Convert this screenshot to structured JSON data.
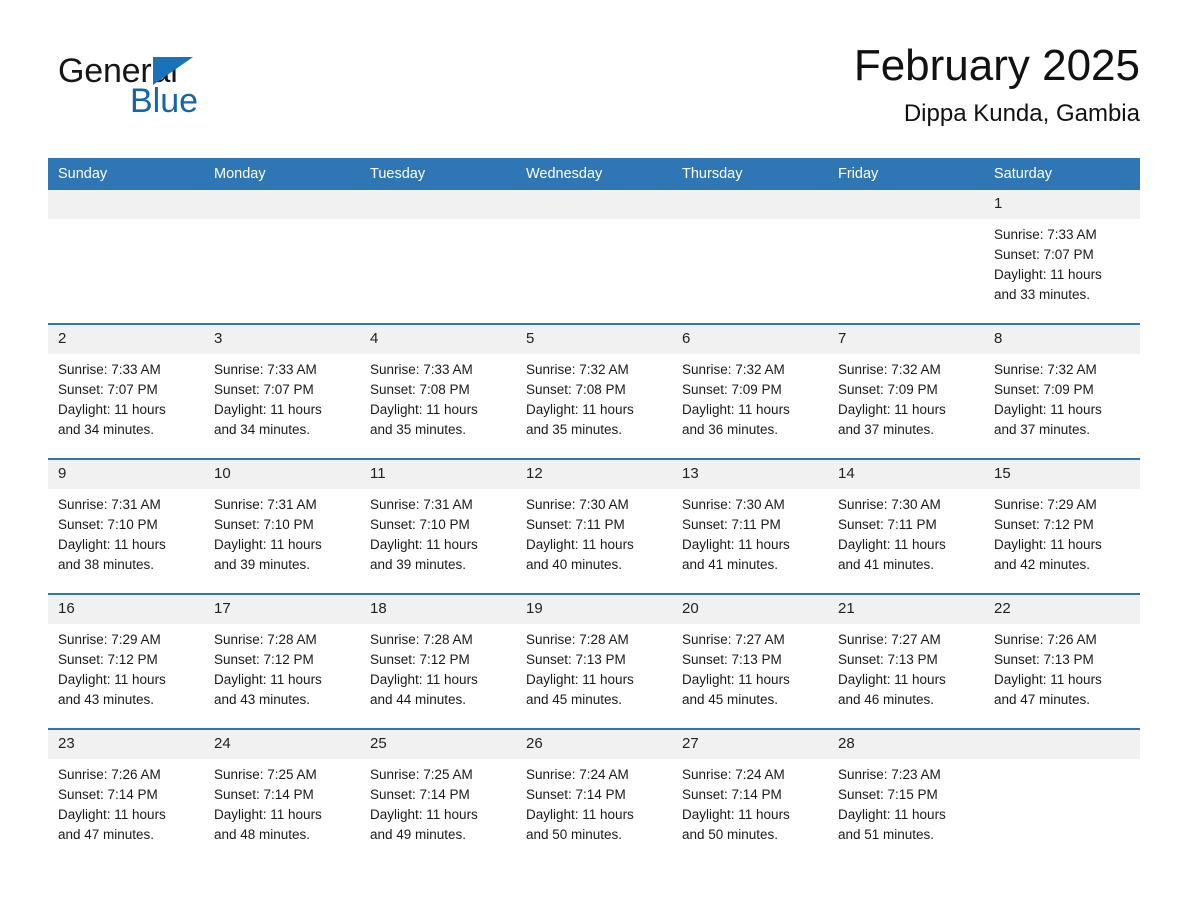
{
  "brand": {
    "name_part1": "General",
    "name_part2": "Blue",
    "triangle_color": "#1c72b8",
    "blue_color": "#1565ac"
  },
  "header": {
    "month_title": "February 2025",
    "location": "Dippa Kunda, Gambia"
  },
  "theme": {
    "header_blue": "#2f76b5",
    "row_divider_blue": "#2f76b5",
    "daynum_band": "#f1f1f1",
    "text": "#1a1a1a"
  },
  "weekday_headers": [
    "Sunday",
    "Monday",
    "Tuesday",
    "Wednesday",
    "Thursday",
    "Friday",
    "Saturday"
  ],
  "labels": {
    "sunrise_prefix": "Sunrise: ",
    "sunset_prefix": "Sunset: ",
    "daylight_prefix": "Daylight: "
  },
  "weeks": [
    [
      {
        "day": "",
        "sunrise": "",
        "sunset": "",
        "daylight_line1": "",
        "daylight_line2": ""
      },
      {
        "day": "",
        "sunrise": "",
        "sunset": "",
        "daylight_line1": "",
        "daylight_line2": ""
      },
      {
        "day": "",
        "sunrise": "",
        "sunset": "",
        "daylight_line1": "",
        "daylight_line2": ""
      },
      {
        "day": "",
        "sunrise": "",
        "sunset": "",
        "daylight_line1": "",
        "daylight_line2": ""
      },
      {
        "day": "",
        "sunrise": "",
        "sunset": "",
        "daylight_line1": "",
        "daylight_line2": ""
      },
      {
        "day": "",
        "sunrise": "",
        "sunset": "",
        "daylight_line1": "",
        "daylight_line2": ""
      },
      {
        "day": "1",
        "sunrise": "Sunrise: 7:33 AM",
        "sunset": "Sunset: 7:07 PM",
        "daylight_line1": "Daylight: 11 hours",
        "daylight_line2": "and 33 minutes."
      }
    ],
    [
      {
        "day": "2",
        "sunrise": "Sunrise: 7:33 AM",
        "sunset": "Sunset: 7:07 PM",
        "daylight_line1": "Daylight: 11 hours",
        "daylight_line2": "and 34 minutes."
      },
      {
        "day": "3",
        "sunrise": "Sunrise: 7:33 AM",
        "sunset": "Sunset: 7:07 PM",
        "daylight_line1": "Daylight: 11 hours",
        "daylight_line2": "and 34 minutes."
      },
      {
        "day": "4",
        "sunrise": "Sunrise: 7:33 AM",
        "sunset": "Sunset: 7:08 PM",
        "daylight_line1": "Daylight: 11 hours",
        "daylight_line2": "and 35 minutes."
      },
      {
        "day": "5",
        "sunrise": "Sunrise: 7:32 AM",
        "sunset": "Sunset: 7:08 PM",
        "daylight_line1": "Daylight: 11 hours",
        "daylight_line2": "and 35 minutes."
      },
      {
        "day": "6",
        "sunrise": "Sunrise: 7:32 AM",
        "sunset": "Sunset: 7:09 PM",
        "daylight_line1": "Daylight: 11 hours",
        "daylight_line2": "and 36 minutes."
      },
      {
        "day": "7",
        "sunrise": "Sunrise: 7:32 AM",
        "sunset": "Sunset: 7:09 PM",
        "daylight_line1": "Daylight: 11 hours",
        "daylight_line2": "and 37 minutes."
      },
      {
        "day": "8",
        "sunrise": "Sunrise: 7:32 AM",
        "sunset": "Sunset: 7:09 PM",
        "daylight_line1": "Daylight: 11 hours",
        "daylight_line2": "and 37 minutes."
      }
    ],
    [
      {
        "day": "9",
        "sunrise": "Sunrise: 7:31 AM",
        "sunset": "Sunset: 7:10 PM",
        "daylight_line1": "Daylight: 11 hours",
        "daylight_line2": "and 38 minutes."
      },
      {
        "day": "10",
        "sunrise": "Sunrise: 7:31 AM",
        "sunset": "Sunset: 7:10 PM",
        "daylight_line1": "Daylight: 11 hours",
        "daylight_line2": "and 39 minutes."
      },
      {
        "day": "11",
        "sunrise": "Sunrise: 7:31 AM",
        "sunset": "Sunset: 7:10 PM",
        "daylight_line1": "Daylight: 11 hours",
        "daylight_line2": "and 39 minutes."
      },
      {
        "day": "12",
        "sunrise": "Sunrise: 7:30 AM",
        "sunset": "Sunset: 7:11 PM",
        "daylight_line1": "Daylight: 11 hours",
        "daylight_line2": "and 40 minutes."
      },
      {
        "day": "13",
        "sunrise": "Sunrise: 7:30 AM",
        "sunset": "Sunset: 7:11 PM",
        "daylight_line1": "Daylight: 11 hours",
        "daylight_line2": "and 41 minutes."
      },
      {
        "day": "14",
        "sunrise": "Sunrise: 7:30 AM",
        "sunset": "Sunset: 7:11 PM",
        "daylight_line1": "Daylight: 11 hours",
        "daylight_line2": "and 41 minutes."
      },
      {
        "day": "15",
        "sunrise": "Sunrise: 7:29 AM",
        "sunset": "Sunset: 7:12 PM",
        "daylight_line1": "Daylight: 11 hours",
        "daylight_line2": "and 42 minutes."
      }
    ],
    [
      {
        "day": "16",
        "sunrise": "Sunrise: 7:29 AM",
        "sunset": "Sunset: 7:12 PM",
        "daylight_line1": "Daylight: 11 hours",
        "daylight_line2": "and 43 minutes."
      },
      {
        "day": "17",
        "sunrise": "Sunrise: 7:28 AM",
        "sunset": "Sunset: 7:12 PM",
        "daylight_line1": "Daylight: 11 hours",
        "daylight_line2": "and 43 minutes."
      },
      {
        "day": "18",
        "sunrise": "Sunrise: 7:28 AM",
        "sunset": "Sunset: 7:12 PM",
        "daylight_line1": "Daylight: 11 hours",
        "daylight_line2": "and 44 minutes."
      },
      {
        "day": "19",
        "sunrise": "Sunrise: 7:28 AM",
        "sunset": "Sunset: 7:13 PM",
        "daylight_line1": "Daylight: 11 hours",
        "daylight_line2": "and 45 minutes."
      },
      {
        "day": "20",
        "sunrise": "Sunrise: 7:27 AM",
        "sunset": "Sunset: 7:13 PM",
        "daylight_line1": "Daylight: 11 hours",
        "daylight_line2": "and 45 minutes."
      },
      {
        "day": "21",
        "sunrise": "Sunrise: 7:27 AM",
        "sunset": "Sunset: 7:13 PM",
        "daylight_line1": "Daylight: 11 hours",
        "daylight_line2": "and 46 minutes."
      },
      {
        "day": "22",
        "sunrise": "Sunrise: 7:26 AM",
        "sunset": "Sunset: 7:13 PM",
        "daylight_line1": "Daylight: 11 hours",
        "daylight_line2": "and 47 minutes."
      }
    ],
    [
      {
        "day": "23",
        "sunrise": "Sunrise: 7:26 AM",
        "sunset": "Sunset: 7:14 PM",
        "daylight_line1": "Daylight: 11 hours",
        "daylight_line2": "and 47 minutes."
      },
      {
        "day": "24",
        "sunrise": "Sunrise: 7:25 AM",
        "sunset": "Sunset: 7:14 PM",
        "daylight_line1": "Daylight: 11 hours",
        "daylight_line2": "and 48 minutes."
      },
      {
        "day": "25",
        "sunrise": "Sunrise: 7:25 AM",
        "sunset": "Sunset: 7:14 PM",
        "daylight_line1": "Daylight: 11 hours",
        "daylight_line2": "and 49 minutes."
      },
      {
        "day": "26",
        "sunrise": "Sunrise: 7:24 AM",
        "sunset": "Sunset: 7:14 PM",
        "daylight_line1": "Daylight: 11 hours",
        "daylight_line2": "and 50 minutes."
      },
      {
        "day": "27",
        "sunrise": "Sunrise: 7:24 AM",
        "sunset": "Sunset: 7:14 PM",
        "daylight_line1": "Daylight: 11 hours",
        "daylight_line2": "and 50 minutes."
      },
      {
        "day": "28",
        "sunrise": "Sunrise: 7:23 AM",
        "sunset": "Sunset: 7:15 PM",
        "daylight_line1": "Daylight: 11 hours",
        "daylight_line2": "and 51 minutes."
      },
      {
        "day": "",
        "sunrise": "",
        "sunset": "",
        "daylight_line1": "",
        "daylight_line2": ""
      }
    ]
  ]
}
